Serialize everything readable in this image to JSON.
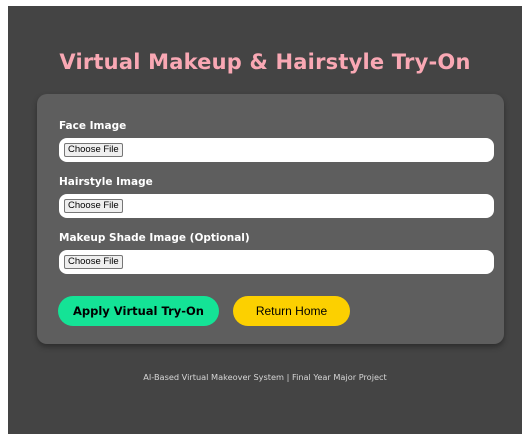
{
  "header": {
    "title": "Virtual Makeup & Hairstyle Try-On"
  },
  "form": {
    "fields": [
      {
        "label": "Face Image",
        "button_label": "Choose File"
      },
      {
        "label": "Hairstyle Image",
        "button_label": "Choose File"
      },
      {
        "label": "Makeup Shade Image (Optional)",
        "button_label": "Choose File"
      }
    ],
    "apply_label": "Apply Virtual Try-On",
    "home_label": "Return Home"
  },
  "footer": {
    "text": "AI-Based Virtual Makeover System | Final Year Major Project"
  },
  "colors": {
    "background": "#444444",
    "card": "#5e5e5e",
    "title": "#f9a8b4",
    "apply_button": "#14e396",
    "home_button": "#fcd000"
  }
}
